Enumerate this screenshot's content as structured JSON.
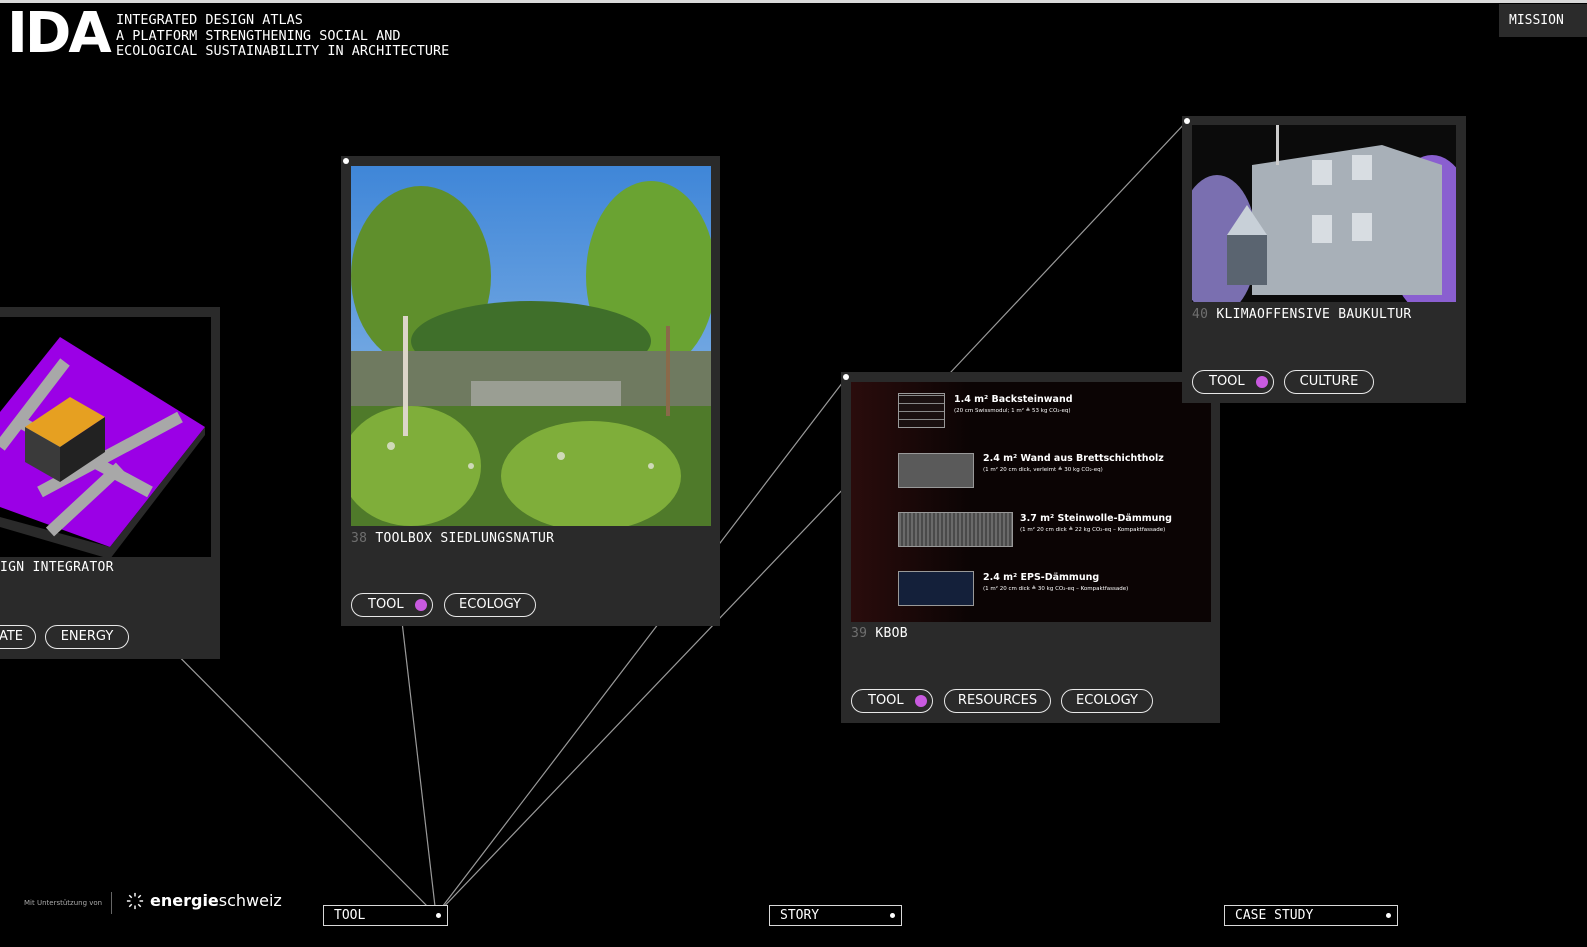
{
  "header": {
    "logo": "IDA",
    "tagline": "INTEGRATED DESIGN ATLAS\nA PLATFORM STRENGTHENING SOCIAL AND\nECOLOGICAL SUSTAINABILITY IN ARCHITECTURE",
    "mission_label": "MISSION"
  },
  "cards": {
    "design_integrator": {
      "title": "IGN INTEGRATOR",
      "tags": [
        "ATE",
        "ENERGY"
      ]
    },
    "toolbox": {
      "number": "38",
      "title": "TOOLBOX SIEDLUNGSNATUR",
      "tags": [
        "TOOL",
        "ECOLOGY"
      ]
    },
    "kbob": {
      "number": "39",
      "title": "KBOB",
      "tags": [
        "TOOL",
        "RESOURCES",
        "ECOLOGY"
      ],
      "materials": [
        {
          "name": "1.4 m² Backsteinwand",
          "detail": "(20 cm Swissmodul; 1 m² ≙ 53 kg CO₂-eq)"
        },
        {
          "name": "2.4 m² Wand aus Brettschichtholz",
          "detail": "(1 m² 20 cm dick, verleimt ≙ 30 kg CO₂-eq)"
        },
        {
          "name": "3.7 m² Steinwolle-Dämmung",
          "detail": "(1 m² 20 cm dick ≙ 22 kg CO₂-eq – Kompaktfassade)"
        },
        {
          "name": "2.4 m² EPS-Dämmung",
          "detail": "(1 m² 20 cm dick ≙ 30 kg CO₂-eq – Kompaktfassade)"
        }
      ]
    },
    "klima": {
      "number": "40",
      "title": "KLIMAOFFENSIVE BAUKULTUR",
      "tags": [
        "TOOL",
        "CULTURE"
      ]
    }
  },
  "filters": {
    "tool": "TOOL",
    "story": "STORY",
    "case_study": "CASE STUDY"
  },
  "sponsor": {
    "support_text": "Mit Unterstützung von",
    "logo_bold": "energie",
    "logo_light": "schweiz"
  },
  "colors": {
    "accent_dot": "#c95ae0",
    "card_bg": "#2a2a2a"
  }
}
